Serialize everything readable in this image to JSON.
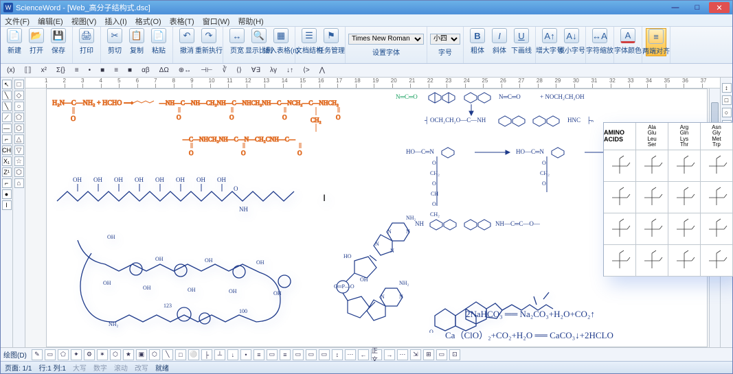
{
  "app": {
    "logo": "W",
    "title": "ScienceWord - [Web_高分子结构式.dsc]"
  },
  "window_controls": {
    "min": "—",
    "max": "□",
    "close": "✕"
  },
  "menu": [
    "文件(F)",
    "编辑(E)",
    "视图(V)",
    "插入(I)",
    "格式(O)",
    "表格(T)",
    "窗口(W)",
    "帮助(H)"
  ],
  "ribbon": {
    "new": "新建",
    "open": "打开",
    "save": "保存",
    "print": "打印",
    "cut": "剪切",
    "copy": "复制",
    "paste": "粘贴",
    "undo": "撤消",
    "redo": "重新执行",
    "pagewidth": "页宽",
    "showratio": "显示比例",
    "inserttable": "插入表格(n)",
    "docstruct": "文档结构",
    "taskmgr": "任务管理",
    "font": "Times New Roman",
    "setfont": "设置字体",
    "fontsize": "小四",
    "fontsize_label": "字号",
    "bold": "B",
    "bold_label": "粗体",
    "italic": "I",
    "italic_label": "斜体",
    "underline": "U",
    "underline_label": "下画线",
    "inc": "增大字号",
    "dec": "减小字号",
    "charscale": "字符缩放",
    "charcolor": "字体颜色",
    "align": "两端对齐"
  },
  "formula_syms": [
    "(x)",
    "⟦⟧",
    "x²",
    "Σ{}",
    "≡",
    "•",
    "■",
    "≡",
    "■",
    "αβ",
    "ΔΩ",
    "⊕↔",
    "⊣⊢",
    "∛",
    "⟨⟩",
    "∀∃",
    "λγ",
    "↓↑",
    "⟨>",
    "⋀"
  ],
  "ruler_ticks": [
    "1",
    "2",
    "3",
    "4",
    "5",
    "6",
    "7",
    "8",
    "9",
    "10",
    "11",
    "12",
    "13",
    "14",
    "15",
    "16",
    "17",
    "18",
    "19",
    "20",
    "21",
    "22",
    "23",
    "24",
    "25",
    "26",
    "27",
    "28",
    "29",
    "30",
    "31",
    "32",
    "33",
    "34",
    "35",
    "36",
    "37"
  ],
  "left_tools": [
    "↖",
    "╲",
    "╲",
    "⟋",
    "—",
    "⌐",
    "CH",
    "X₁",
    "Z¹",
    "⌐",
    "●",
    "I"
  ],
  "shape_tools": [
    "□",
    "◇",
    "○",
    "⬠",
    "⬡",
    "△",
    "▽",
    "☆",
    "⬡",
    "⌂"
  ],
  "right_tools": [
    "↕",
    "□",
    "○",
    "■",
    "●"
  ],
  "bottom_tools": [
    "✎",
    "▭",
    "⬠",
    "✦",
    "⚙",
    "✶",
    "⬡",
    "★",
    "▣",
    "⬡",
    "╲",
    "□",
    "⚪",
    "├",
    "┴",
    "↓",
    "•",
    "≡",
    "▭",
    "≡",
    "▭",
    "▭",
    "▭",
    "↕",
    "⋯",
    "←",
    "正文",
    "→",
    "⋯",
    "⇲",
    "⊞",
    "▭",
    "⊡"
  ],
  "status": {
    "drawing": "绘图(D)",
    "page": "页面: 1/1",
    "line": "行:1 列:1",
    "caps": "大写",
    "num": "数字",
    "scroll": "滚动",
    "over": "改写",
    "ready": "就绪"
  },
  "chem": {
    "reactant": "H₂N—C—NH₂ + HCHO ⟶",
    "frag1": "—NH—C—NH—CH₂NH—C—NHCH₂NH—C—NCH₂—C—NHCH₂",
    "frag2": "—C—NHCH₂NH—C—N—CH₂CNH—C—",
    "O": "O",
    "CH2": "CH₂",
    "isocyan": "N═C═O",
    "plus": "+ NOCH₂CH₂OH",
    "polyseg": "OCH₂CH₂O—C—NH",
    "hnc": "HNC",
    "hoc": "HO—C═N",
    "arrow": "⟶",
    "groups": [
      "O",
      "CH₂",
      "O",
      "CH",
      "O",
      "CH₂",
      "O"
    ],
    "nh": "NH",
    "right_end": "NH—C═C—O—",
    "ohrow": [
      "OH",
      "OH",
      "OH",
      "OH",
      "OH",
      "OH",
      "OH",
      "OH"
    ],
    "nhpart": "NH",
    "cursor": "I",
    "nh2": "NH₂",
    "num123": "123",
    "num100": "100",
    "eq1": "2NaHCO₃ ══ Na₂CO₃+H₂O+CO₂↑",
    "eq2": "Ca（ClO）₂+CO₂+H₂O ══ CaCO₃↓+2HCLO"
  },
  "amino": {
    "title": "AMINO ACIDS",
    "cols": [
      [
        "Ala",
        "Glu",
        "Leu",
        "Ser"
      ],
      [
        "Arg",
        "Gln",
        "Lys",
        "Thr"
      ],
      [
        "Asn",
        "Gly",
        "Met",
        "Trp"
      ]
    ]
  }
}
